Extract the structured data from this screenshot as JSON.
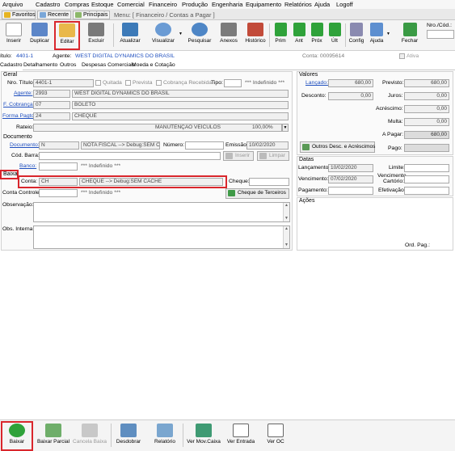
{
  "menu": [
    "Arquivo",
    "Cadastro",
    "Compras",
    "Estoque",
    "Comercial",
    "Financeiro",
    "Produção",
    "Engenharia",
    "Equipamento",
    "Relatórios",
    "Ajuda",
    "Logoff"
  ],
  "navtabs": {
    "favoritos": "Favoritos",
    "recente": "Recente",
    "principais": "Principais",
    "path": "Menu: [ Financeiro / Contas a Pagar ]"
  },
  "toolbar": {
    "inserir": "Inserir",
    "duplicar": "Duplicar",
    "editar": "Editar",
    "excluir": "Excluir",
    "atualizar": "Atualizar",
    "visualizar": "Visualizar",
    "pesquisar": "Pesquisar",
    "anexos": "Anexos",
    "historico": "Histórico",
    "prim": "Prim",
    "ant": "Ant",
    "prox": "Próx",
    "ult": "Últ",
    "config": "Config",
    "ajuda": "Ajuda",
    "fechar": "Fechar",
    "nro_cod_label": "Nro./Cód.:"
  },
  "info": {
    "titulo_label": "ítulo:",
    "titulo_value": "4401-1",
    "agente_label": "Agente:",
    "agente_value": "WEST DIGITAL DYNAMICS DO BRASIL",
    "conta_label": "Conta: 00095614",
    "ativa": "Ativa"
  },
  "detail_tabs": [
    "Cadastro",
    "Detalhamento",
    "Outros",
    "Despesas Comerciais",
    "Moeda e Cotação"
  ],
  "geral": {
    "title": "Geral",
    "nro_titulo_label": "Nro. Título:",
    "nro_titulo_value": "4401-1",
    "quitada": "Quitada",
    "prevista": "Prevista",
    "cobranca": "Cobrança Recebida",
    "tipo_label": "Tipo:",
    "tipo_desc": "*** Indefinido ***",
    "agente_label": "Agente:",
    "agente_code": "2993",
    "agente_desc": "WEST DIGITAL DYNAMICS DO BRASIL",
    "fcobranca_label": "F. Cobrança:",
    "fcobranca_code": "07",
    "fcobranca_desc": "BOLETO",
    "formapagto_label": "Forma Pagto:",
    "formapagto_code": "24",
    "formapagto_desc": "CHEQUE",
    "rateio_label": "Rateio:",
    "rateio_desc": "MANUTENÇÃO VEÍCULOS",
    "rateio_pct": "100,00%"
  },
  "documento": {
    "title": "Documento",
    "documento_label": "Documento:",
    "documento_value": "N",
    "documento_desc": "NOTA FISCAL --> Debug:SEM CAI",
    "numero_label": "Número:",
    "numero_value": "",
    "emissao_label": "Emissão:",
    "emissao_value": "10/02/2020",
    "codbarra_label": "Cód. Barra:",
    "inserir": "Inserir",
    "limpar": "Limpar",
    "banco_label": "Banco:",
    "banco_desc": "*** Indefinido ***"
  },
  "baixa": {
    "title": "Baixa",
    "conta_label": "Conta:",
    "conta_code": "CH",
    "conta_desc": "CHEQUE --> Debug:SEM CACHE",
    "cheque_label": "Cheque:",
    "cheque_value": "",
    "contacontrole_label": "Conta Controle:",
    "contacontrole_desc": "*** Indefinido ***",
    "cheque_terceiros": "Cheque de Terceiros"
  },
  "observacao_label": "Observação:",
  "obs_interna_label": "Obs. Interna:",
  "valores": {
    "title": "Valores",
    "lancado_label": "Lançado:",
    "lancado_value": "680,00",
    "previsto_label": "Previsto:",
    "previsto_value": "680,00",
    "desconto_label": "Desconto:",
    "desconto_value": "0,00",
    "juros_label": "Juros:",
    "juros_value": "0,00",
    "acrescimo_label": "Acréscimo:",
    "acrescimo_value": "0,00",
    "multa_label": "Multa:",
    "multa_value": "0,00",
    "apagar_label": "A Pagar:",
    "apagar_value": "680,00",
    "pago_label": "Pago:",
    "pago_value": "",
    "outros_btn": "Outros Desc. e Acréscimos"
  },
  "datas": {
    "title": "Datas",
    "lancamento_label": "Lançamento:",
    "lancamento_value": "10/02/2020",
    "limite_label": "Limite:",
    "limite_value": "",
    "vencimento_label": "Vencimento:",
    "vencimento_value": "07/02/2020",
    "venc_cartorio_label1": "Vencimento",
    "venc_cartorio_label2": "Cartório:",
    "venc_cartorio_value": "",
    "pagamento_label": "Pagamento:",
    "pagamento_value": "",
    "efetivacao_label": "Efetivação:",
    "efetivacao_value": ""
  },
  "acoes": {
    "title": "Ações",
    "ordpag_label": "Ord. Pag.:"
  },
  "bottom": {
    "baixar": "Baixar",
    "baixar_parcial": "Baixar Parcial",
    "cancela_baixa": "Cancela Baixa",
    "desdobrar": "Desdobrar",
    "relatorio": "Relatório",
    "ver_movcaixa": "Ver Mov.Caixa",
    "ver_entrada": "Ver Entrada",
    "ver_oc": "Ver OC"
  },
  "colors": {
    "highlight": "#d9262c",
    "link": "#1f4fbf",
    "toolbar": "#f4f4f4",
    "green_arrow": "#2fa23a"
  }
}
